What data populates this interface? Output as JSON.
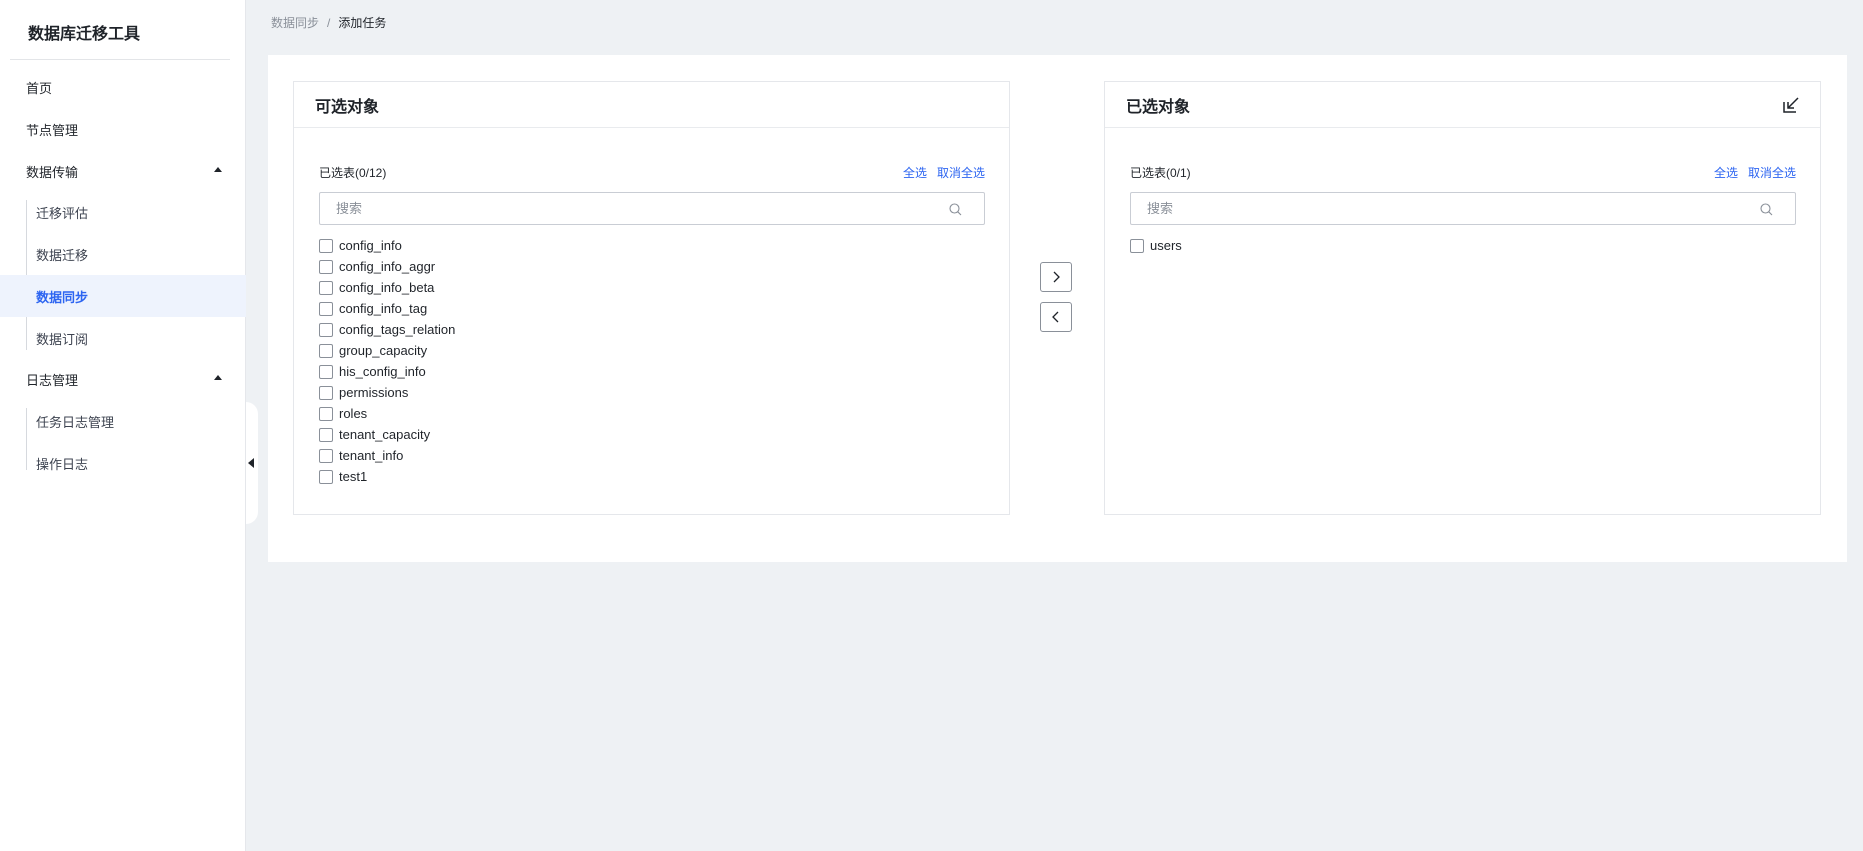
{
  "sidebar": {
    "app_title": "数据库迁移工具",
    "items": {
      "home": "首页",
      "nodes": "节点管理",
      "transfer_group": "数据传输",
      "assess": "迁移评估",
      "migrate": "数据迁移",
      "sync": "数据同步",
      "subscribe": "数据订阅",
      "log_group": "日志管理",
      "task_log": "任务日志管理",
      "op_log": "操作日志"
    },
    "active": "sync"
  },
  "breadcrumb": {
    "parent": "数据同步",
    "separator": "/",
    "current": "添加任务"
  },
  "left_panel": {
    "title": "可选对象",
    "count_label": "已选表(0/12)",
    "select_all": "全选",
    "deselect_all": "取消全选",
    "search_placeholder": "搜索",
    "tables": [
      "config_info",
      "config_info_aggr",
      "config_info_beta",
      "config_info_tag",
      "config_tags_relation",
      "group_capacity",
      "his_config_info",
      "permissions",
      "roles",
      "tenant_capacity",
      "tenant_info",
      "test1"
    ]
  },
  "right_panel": {
    "title": "已选对象",
    "count_label": "已选表(0/1)",
    "select_all": "全选",
    "deselect_all": "取消全选",
    "search_placeholder": "搜索",
    "tables": [
      "users"
    ]
  },
  "colors": {
    "accent": "#2d65f1",
    "background": "#eef1f4"
  },
  "icons": {
    "move_right": "chevron-right-icon",
    "move_left": "chevron-left-icon",
    "export": "export-icon",
    "search": "search-icon",
    "collapse": "collapse-left-icon"
  }
}
